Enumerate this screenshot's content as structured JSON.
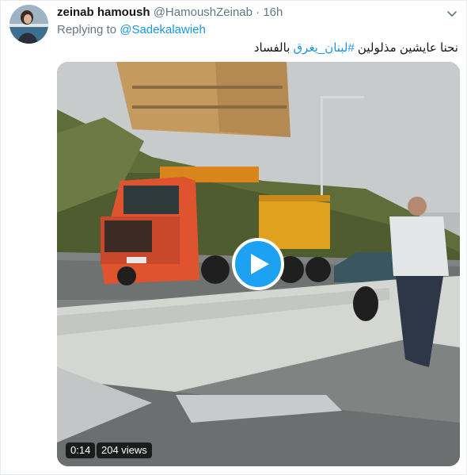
{
  "tweet": {
    "display_name": "zeinab hamoush",
    "handle": "@HamoushZeinab",
    "separator": "·",
    "time": "16h",
    "reply_prefix": "Replying to",
    "reply_handle": "@Sadekalawieh",
    "text_before": "نحنا عايشين مذلولين ",
    "hashtag": "#لبنان_يغرق",
    "text_after": " بالفساد"
  },
  "video": {
    "duration": "0:14",
    "views": "204 views"
  },
  "colors": {
    "link": "#1b95e0",
    "play_button": "#1da1f2",
    "secondary_text": "#657786"
  },
  "icons": {
    "menu": "chevron-down-icon",
    "play": "play-icon"
  }
}
